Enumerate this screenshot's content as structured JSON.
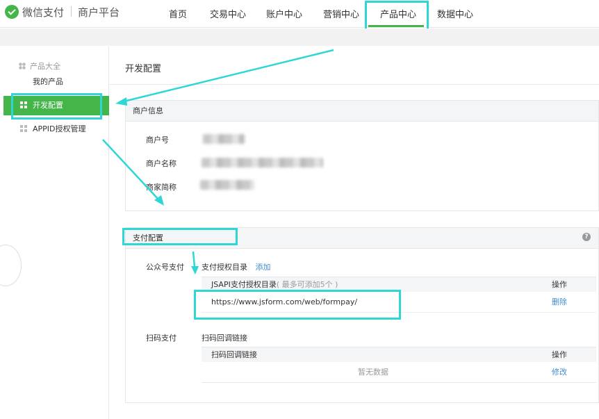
{
  "header": {
    "brand": "微信支付",
    "platform": "商户平台",
    "nav": [
      "首页",
      "交易中心",
      "账户中心",
      "营销中心",
      "产品中心",
      "数据中心"
    ],
    "active_nav": "产品中心"
  },
  "sidebar": {
    "section_title": "产品大全",
    "items": [
      "我的产品",
      "开发配置",
      "APPID授权管理"
    ],
    "active_item": "开发配置"
  },
  "page": {
    "title": "开发配置"
  },
  "merchant_info": {
    "title": "商户信息",
    "fields": [
      "商户号",
      "商户名称",
      "商家简称"
    ]
  },
  "payment_config": {
    "title": "支付配置",
    "jsapi": {
      "label": "公众号支付",
      "subtitle": "支付授权目录",
      "add_link": "添加",
      "table_header": "JSAPI支付授权目录",
      "table_header_note": "( 最多可添加5个 )",
      "op_header": "操作",
      "row_url": "https://www.jsform.com/web/formpay/",
      "row_op": "删除"
    },
    "scan": {
      "label": "扫码支付",
      "subtitle": "扫码回调链接",
      "table_header": "扫码回调链接",
      "op_header": "操作",
      "empty_text": "暂无数据",
      "row_op": "修改"
    }
  },
  "colors": {
    "brand_green": "#44b549",
    "highlight": "#2ed6d6",
    "link": "#3f8ccf"
  }
}
